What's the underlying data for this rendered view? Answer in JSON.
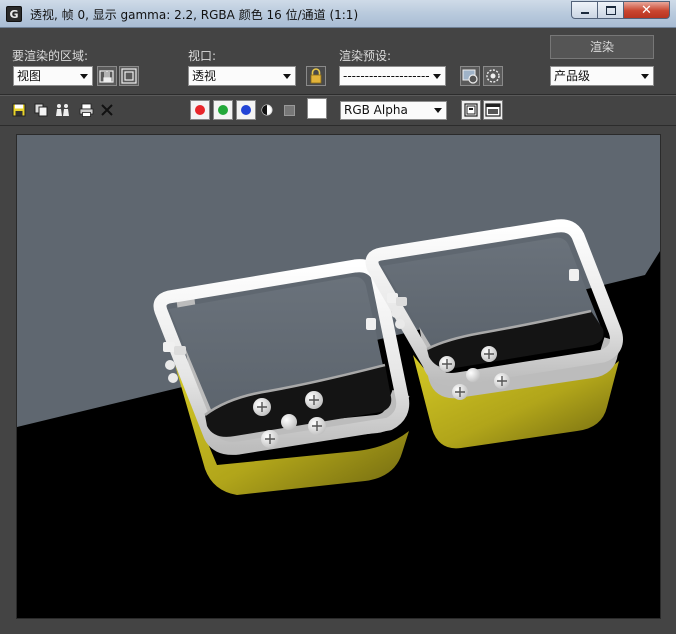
{
  "window": {
    "title": "透视, 帧 0, 显示 gamma: 2.2, RGBA 颜色 16 位/通道 (1:1)",
    "app_icon": "3ds-max-icon",
    "minimize_icon": "minimize-icon",
    "maximize_icon": "maximize-icon",
    "close_icon": "close-icon"
  },
  "render_area": {
    "label": "要渲染的区域:",
    "selected": "视图",
    "icons": [
      "edit-region-icon",
      "auto-region-icon"
    ]
  },
  "viewport": {
    "label": "视口:",
    "selected": "透视",
    "lock_icon": "lock-icon"
  },
  "preset": {
    "label": "渲染预设:",
    "selected": "--------------------",
    "icons": [
      "render-setup-icon",
      "environment-effects-icon"
    ]
  },
  "render_button": {
    "label": "渲染"
  },
  "quality": {
    "selected": "产品级"
  },
  "toolbar": {
    "icons": [
      "save-image-icon",
      "copy-image-icon",
      "clone-window-icon",
      "print-icon",
      "clear-icon"
    ],
    "channels": [
      {
        "name": "red-channel",
        "color": "#e8262a"
      },
      {
        "name": "green-channel",
        "color": "#23a83a"
      },
      {
        "name": "blue-channel",
        "color": "#2244d6"
      }
    ],
    "alpha_icon": "alpha-channel-icon",
    "mono_icon": "monochrome-icon",
    "swatch_color": "#ffffff",
    "display_channel": "RGB Alpha",
    "panel_icons": [
      "toggle-ui-overlay-icon",
      "toggle-ui-icon"
    ]
  },
  "scene": {
    "background_color": "#5f6770",
    "floor_color": "#000000",
    "object_body_color": "#b8ad1c",
    "object_frame_color": "#f2f2f2"
  }
}
